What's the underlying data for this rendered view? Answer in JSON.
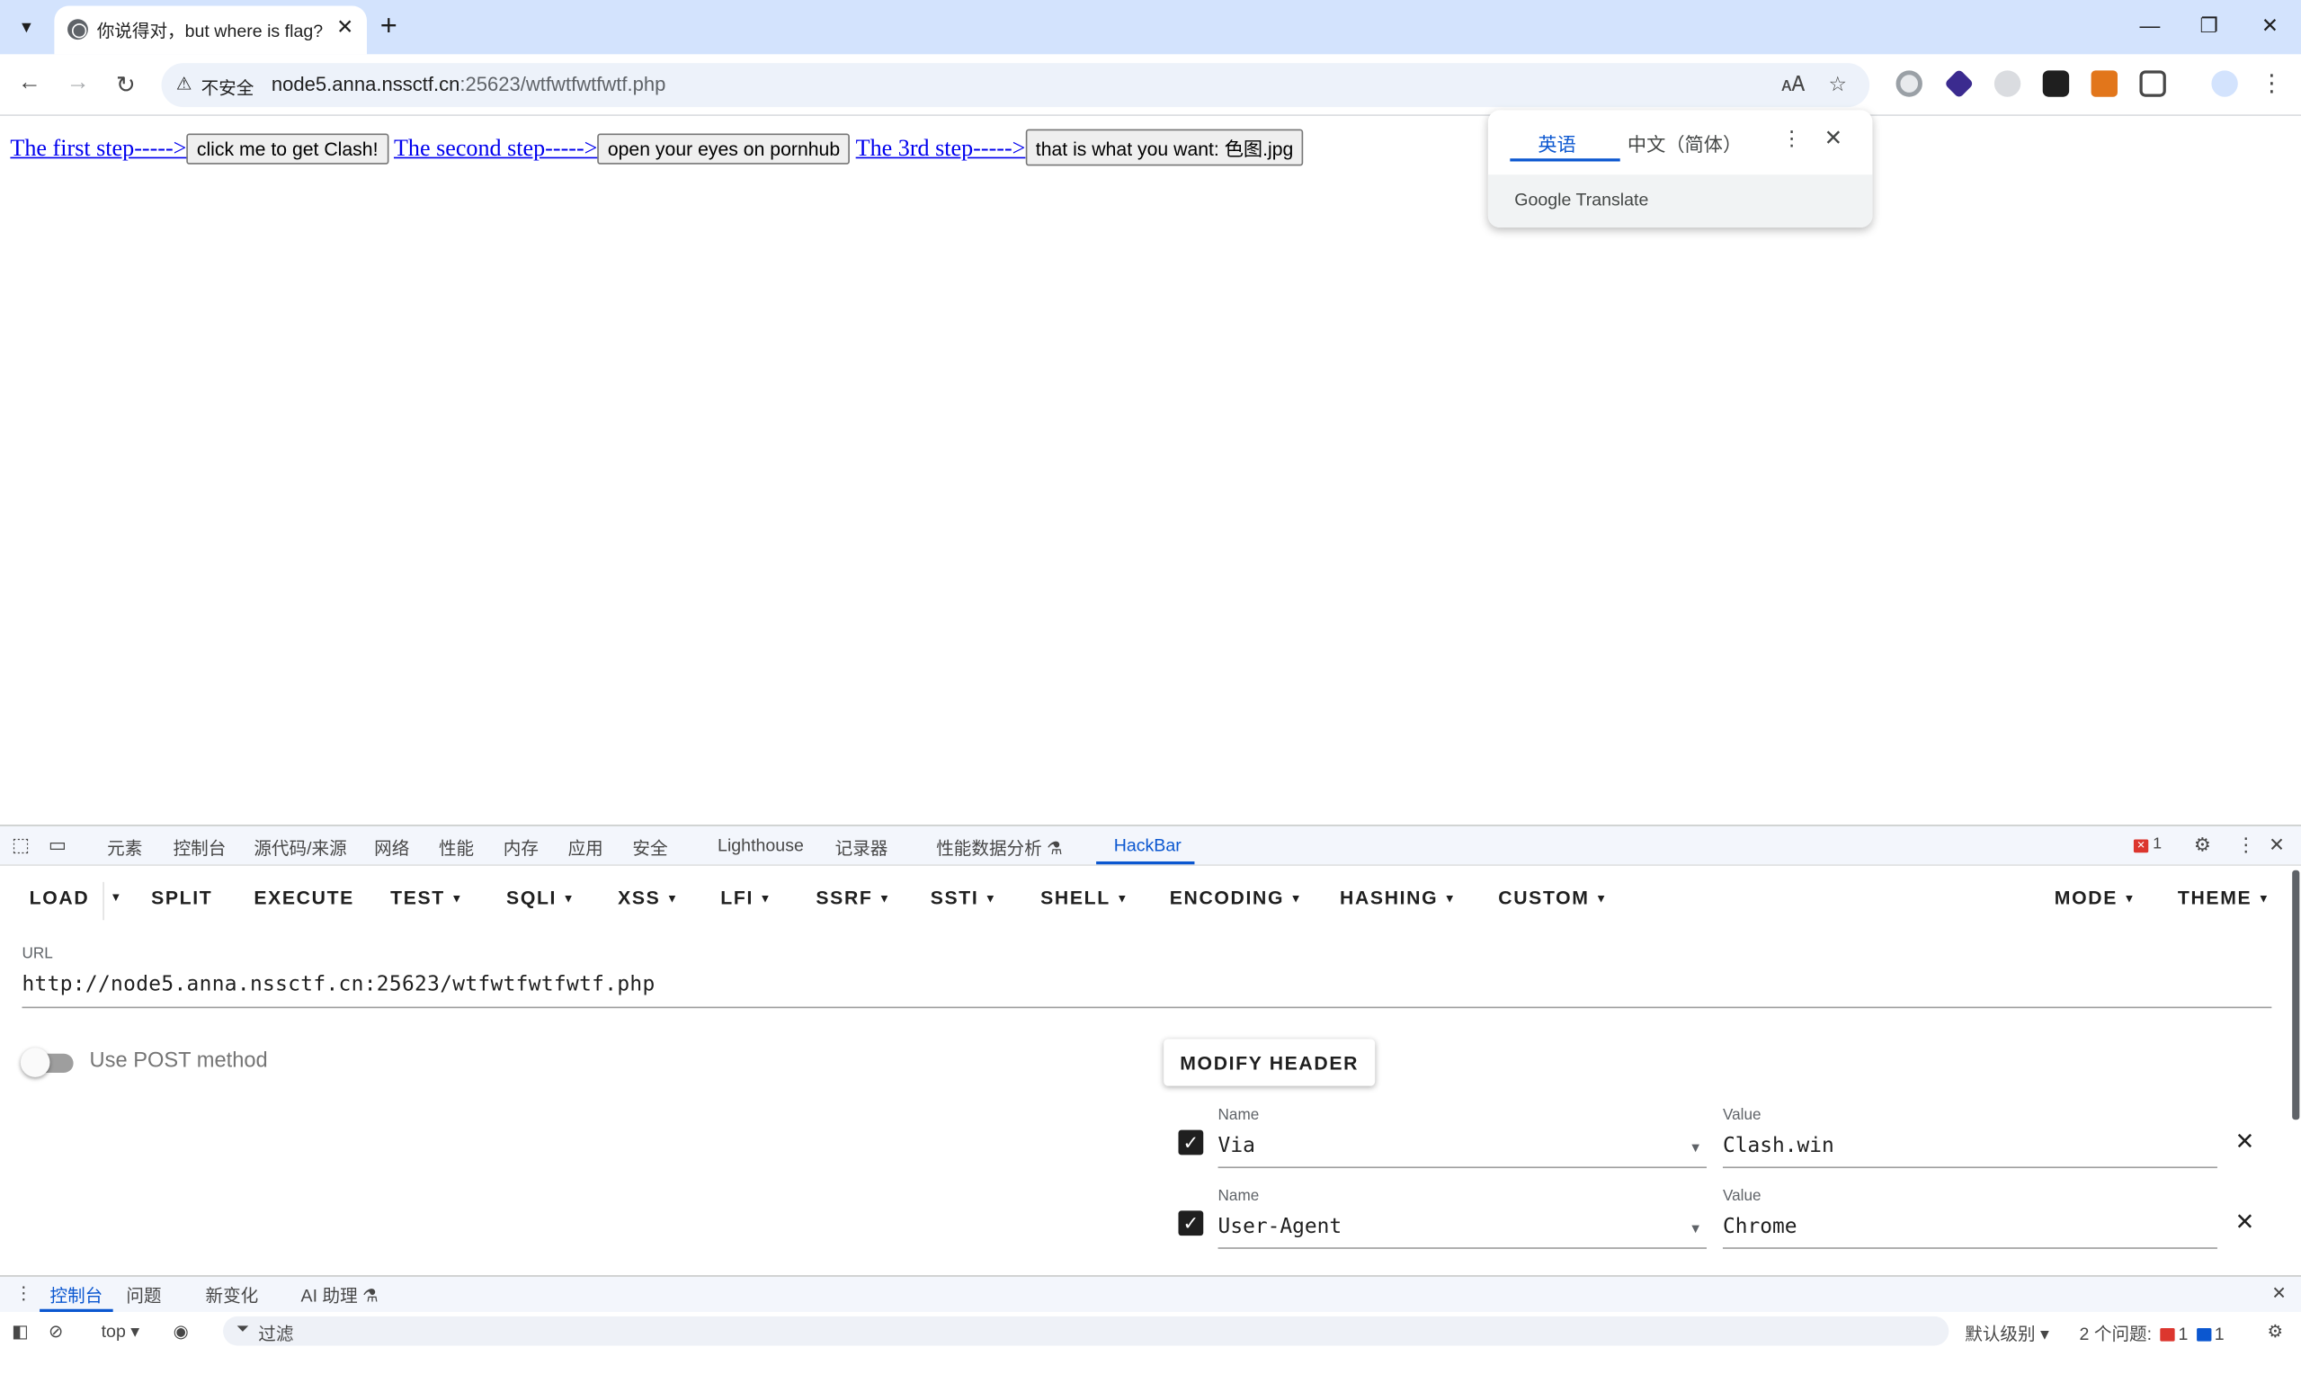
{
  "browser": {
    "tab_title": "你说得对，but where is flag?",
    "insecure_label": "不安全",
    "url_host": "node5.anna.nssctf.cn",
    "url_rest": ":25623/wtfwtfwtfwtf.php"
  },
  "page": {
    "step1_link": "The first step----->",
    "step1_button": "click me to get Clash!",
    "step2_link": "The second step----->",
    "step2_button": "open your eyes on pornhub",
    "step3_link": "The 3rd step----->",
    "step3_button": "that is what you want: 色图.jpg"
  },
  "translate_popup": {
    "source_lang": "英语",
    "target_lang": "中文（简体）",
    "brand": "Google Translate"
  },
  "devtools": {
    "tabs": [
      "元素",
      "控制台",
      "源代码/来源",
      "网络",
      "性能",
      "内存",
      "应用",
      "安全",
      "Lighthouse",
      "记录器",
      "性能数据分析 ⚗",
      "HackBar"
    ],
    "active_tab": "HackBar",
    "error_count": "1"
  },
  "hackbar": {
    "menu": {
      "load": "LOAD",
      "split": "SPLIT",
      "execute": "EXECUTE",
      "test": "TEST",
      "sqli": "SQLI",
      "xss": "XSS",
      "lfi": "LFI",
      "ssrf": "SSRF",
      "ssti": "SSTI",
      "shell": "SHELL",
      "encoding": "ENCODING",
      "hashing": "HASHING",
      "custom": "CUSTOM",
      "mode": "MODE",
      "theme": "THEME"
    },
    "url_label": "URL",
    "url_value": "http://node5.anna.nssctf.cn:25623/wtfwtfwtfwtf.php",
    "post_toggle_label": "Use POST method",
    "post_enabled": false,
    "modify_header_label": "MODIFY HEADER",
    "headers": [
      {
        "name_label": "Name",
        "name": "Via",
        "value_label": "Value",
        "value": "Clash.win",
        "enabled": true
      },
      {
        "name_label": "Name",
        "name": "User-Agent",
        "value_label": "Value",
        "value": "Chrome",
        "enabled": true
      }
    ]
  },
  "drawer": {
    "tabs": [
      "控制台",
      "问题",
      "新变化",
      "AI 助理 ⚗"
    ],
    "context": "top",
    "filter_placeholder": "过滤",
    "level": "默认级别",
    "issues_label": "2 个问题:",
    "issues_errors": "1",
    "issues_info": "1"
  },
  "colors": {
    "tabstrip_bg": "#d3e3fd",
    "accent": "#0b57d0",
    "link": "#0000ee",
    "error": "#dc362e"
  }
}
